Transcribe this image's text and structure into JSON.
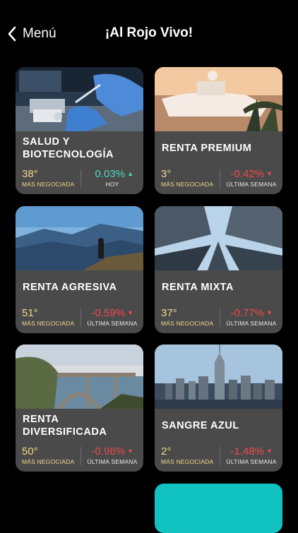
{
  "nav": {
    "back_label": "Menú",
    "title": "¡Al Rojo Vivo!"
  },
  "colors": {
    "accent_up": "#4ed6c2",
    "accent_down": "#f0494b",
    "rank": "#f0d98a",
    "card_bg": "#4a4a4a",
    "teal_card": "#11c2c3"
  },
  "cards": [
    {
      "name": "SALUD Y BIOTECNOLOGÍA",
      "rank": "38°",
      "rank_label": "MÁS NEGOCIADA",
      "change": "0.03%",
      "direction": "up",
      "period": "HOY"
    },
    {
      "name": "RENTA PREMIUM",
      "rank": "3°",
      "rank_label": "MÁS NEGOCIADA",
      "change": "-0.42%",
      "direction": "down",
      "period": "ÚLTIMA SEMANA"
    },
    {
      "name": "RENTA AGRESIVA",
      "rank": "51°",
      "rank_label": "MÁS NEGOCIADA",
      "change": "-0.59%",
      "direction": "down",
      "period": "ÚLTIMA SEMANA"
    },
    {
      "name": "RENTA MIXTA",
      "rank": "37°",
      "rank_label": "MÁS NEGOCIADA",
      "change": "-0.77%",
      "direction": "down",
      "period": "ÚLTIMA SEMANA"
    },
    {
      "name": "RENTA DIVERSIFICADA",
      "rank": "50°",
      "rank_label": "MÁS NEGOCIADA",
      "change": "-0.96%",
      "direction": "down",
      "period": "ÚLTIMA SEMANA"
    },
    {
      "name": "SANGRE AZUL",
      "rank": "2°",
      "rank_label": "MÁS NEGOCIADA",
      "change": "-1.48%",
      "direction": "down",
      "period": "ÚLTIMA SEMANA"
    }
  ]
}
